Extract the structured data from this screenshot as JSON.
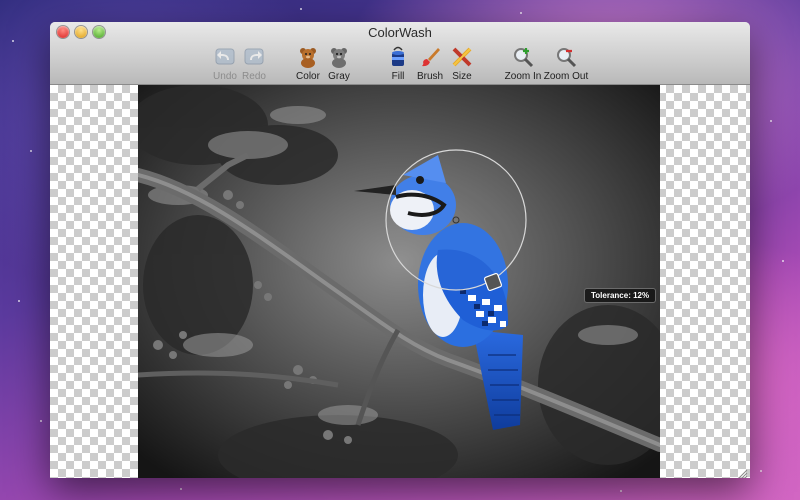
{
  "window": {
    "title": "ColorWash"
  },
  "toolbar": {
    "items": [
      {
        "label": "Undo",
        "icon": "undo-icon",
        "enabled": false
      },
      {
        "label": "Redo",
        "icon": "redo-icon",
        "enabled": false
      },
      {
        "label": "Color",
        "icon": "color-bear-icon",
        "enabled": true
      },
      {
        "label": "Gray",
        "icon": "gray-bear-icon",
        "enabled": true
      },
      {
        "label": "Fill",
        "icon": "paint-bucket-icon",
        "enabled": true
      },
      {
        "label": "Brush",
        "icon": "brush-icon",
        "enabled": true
      },
      {
        "label": "Size",
        "icon": "size-icon",
        "enabled": true
      },
      {
        "label": "Zoom In",
        "icon": "zoom-in-icon",
        "enabled": true
      },
      {
        "label": "Zoom Out",
        "icon": "zoom-out-icon",
        "enabled": true
      }
    ]
  },
  "canvas": {
    "tolerance_label": "Tolerance: 12%"
  },
  "colors": {
    "bird_blue": "#2b6fe0",
    "bird_blue_dark": "#1c3f9e",
    "toolbar_top": "#e9e9e9",
    "toolbar_bottom": "#b9b9b9"
  }
}
